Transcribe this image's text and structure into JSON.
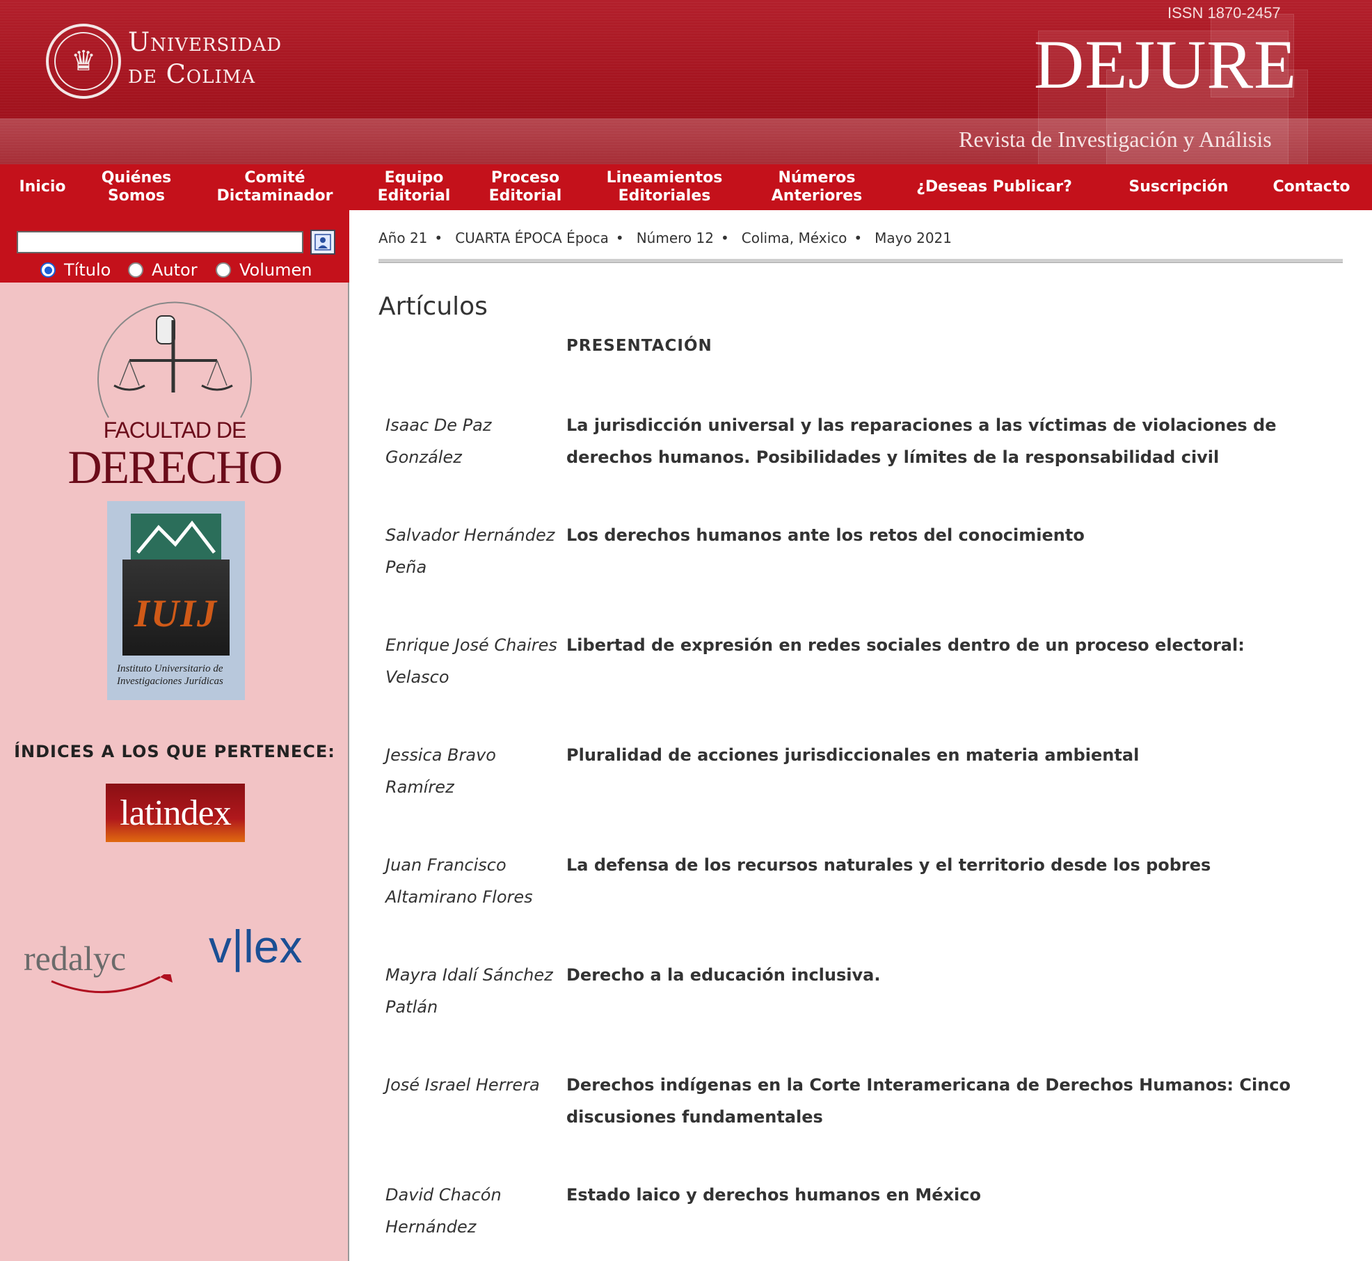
{
  "header": {
    "university_line1": "Universidad",
    "university_line2": "de Colima",
    "issn": "ISSN 1870-2457",
    "journal": "DEJURE",
    "subtitle": "Revista de Investigación y Análisis"
  },
  "nav": [
    {
      "label": "Inicio"
    },
    {
      "label": "Quiénes\nSomos"
    },
    {
      "label": "Comité\nDictaminador"
    },
    {
      "label": "Equipo\nEditorial"
    },
    {
      "label": "Proceso\nEditorial"
    },
    {
      "label": "Lineamientos\nEditoriales"
    },
    {
      "label": "Números\nAnteriores"
    },
    {
      "label": "¿Deseas Publicar?"
    },
    {
      "label": "Suscripción"
    },
    {
      "label": "Contacto"
    }
  ],
  "search": {
    "value": "",
    "options": [
      "Título",
      "Autor",
      "Volumen"
    ],
    "selected": "Título"
  },
  "sidebar": {
    "faculty_line1": "FACULTAD DE",
    "faculty_line2": "DERECHO",
    "iuij_letters": "IUIJ",
    "iuij_caption": "Instituto Universitario de Investigaciones Jurídicas",
    "indices_heading": "ÍNDICES A LOS QUE PERTENECE:",
    "latindex": "latindex",
    "redalyc": "redalyc",
    "vlex": "v|lex"
  },
  "issue": {
    "year": "Año 21",
    "epoch": "CUARTA ÉPOCA Época",
    "number": "Número 12",
    "place": "Colima, México",
    "date": "Mayo 2021"
  },
  "main": {
    "section_title": "Artículos",
    "presentation": "PRESENTACIÓN",
    "articles": [
      {
        "author": "Isaac De Paz González",
        "title": "La jurisdicción universal y las reparaciones a las víctimas de violaciones de derechos humanos. Posibilidades y límites de la responsabilidad civil"
      },
      {
        "author": "Salvador Hernández Peña",
        "title": "Los derechos humanos ante los retos del conocimiento"
      },
      {
        "author": "Enrique José Chaires Velasco",
        "title": "Libertad de expresión en redes sociales dentro de un proceso electoral:"
      },
      {
        "author": "Jessica Bravo Ramírez",
        "title": "Pluralidad de acciones jurisdiccionales en materia ambiental"
      },
      {
        "author": "Juan Francisco Altamirano Flores",
        "title": "La defensa de los recursos naturales y el territorio desde los pobres"
      },
      {
        "author": "Mayra Idalí Sánchez Patlán",
        "title": "Derecho a la educación inclusiva."
      },
      {
        "author": "José Israel Herrera",
        "title": "Derechos indígenas en la Corte Interamericana de Derechos Humanos: Cinco discusiones fundamentales"
      },
      {
        "author": "David Chacón Hernández",
        "title": "Estado laico y derechos humanos en México"
      }
    ]
  }
}
